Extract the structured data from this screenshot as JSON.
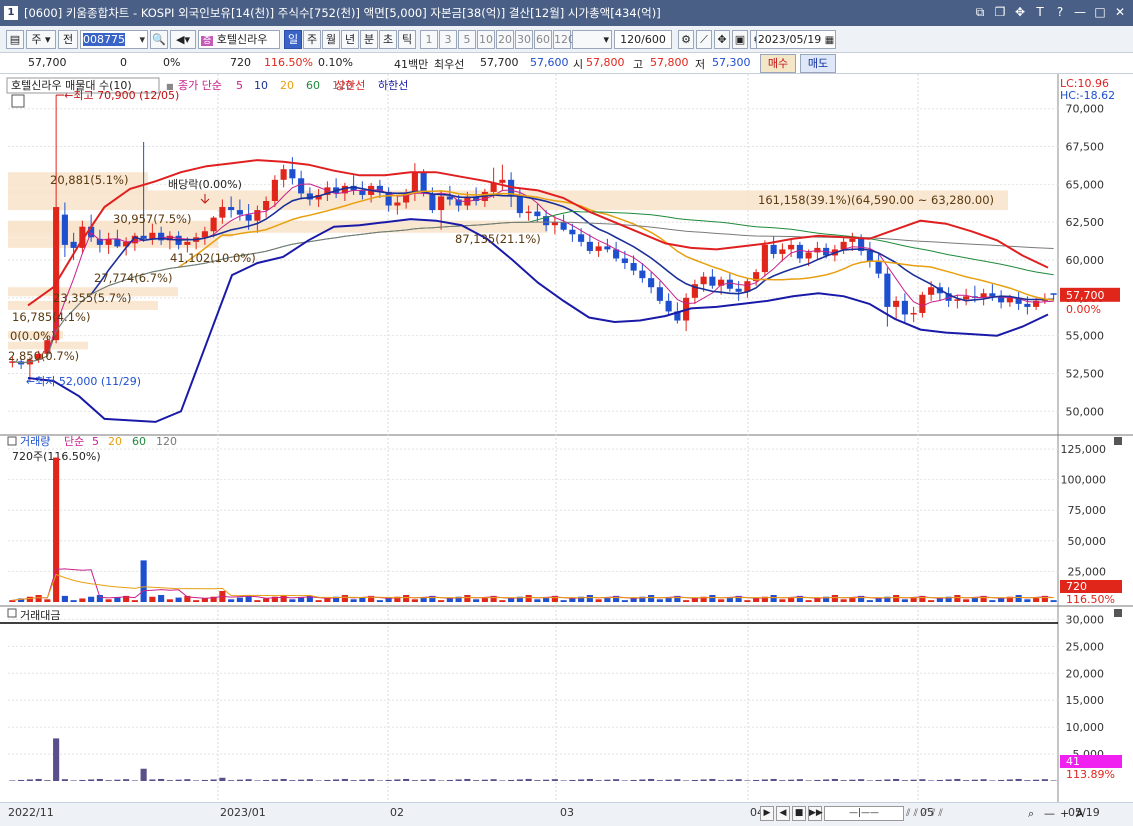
{
  "window": {
    "number": "1",
    "title": "[0600] 키움종합차트 - KOSPI 외국인보유[14(천)] 주식수[752(천)] 액면[5,000] 자본금[38(억)] 결산[12월] 시가총액[434(억)]",
    "controls": [
      "⧉",
      "❐",
      "✥",
      "T",
      "?",
      "—",
      "□",
      "✕"
    ]
  },
  "toolbar": {
    "market": "주",
    "prev_label": "전",
    "stock_code": "008775",
    "stock_name": "호텔신라우",
    "periods": [
      "일",
      "주",
      "월",
      "년",
      "분",
      "초",
      "틱"
    ],
    "selected_period": "일",
    "intervals": [
      "1",
      "3",
      "5",
      "10",
      "20",
      "30",
      "60",
      "120"
    ],
    "count": "120/600",
    "date": "2023/05/19"
  },
  "quote": {
    "price": "57,700",
    "change": "0",
    "change_pct": "0%",
    "volume": "720",
    "volume_ratio": "116.50%",
    "turnover": "0.10%",
    "amount": "41백만",
    "best_label": "최우선",
    "best": "57,700",
    "best2": "57,600",
    "open_label": "시",
    "open": "57,800",
    "high_label": "고",
    "high": "57,800",
    "low_label": "저",
    "low": "57,300",
    "buy_label": "매수",
    "sell_label": "매도"
  },
  "price_panel": {
    "legend_name": "호텔신라우 매물대 수(10)",
    "legend_ma": "종가 단순",
    "legend_periods": [
      "5",
      "10",
      "20",
      "60",
      "120"
    ],
    "legend_upper": "상한선",
    "legend_lower": "하한선",
    "lc": "LC:10.96",
    "hc": "HC:-18.62",
    "y_ticks": [
      "70,000",
      "67,500",
      "65,000",
      "62,500",
      "60,000",
      "57,500",
      "55,000",
      "52,500",
      "50,000"
    ],
    "current_price_tag": "57,700",
    "current_pct": "0.00%",
    "max_label": "최고 70,900 (12/05)",
    "min_label": "최저 52,000 (11/29)",
    "dividend_label": "배당락(0.00%)",
    "volume_profile_labels": [
      "20,881(5.1%)",
      "30,957(7.5%)",
      "41,102(10.0%)",
      "27,774(6.7%)",
      "23,355(5.7%)",
      "16,785(4.1%)",
      "0(0.0%)",
      "2,850(0.7%)",
      "87,135(21.1%)",
      "161,158(39.1%)(64,590.00 ~ 63,280.00)"
    ]
  },
  "volume_panel": {
    "legend_name": "거래량",
    "legend_ma": "단순",
    "legend_periods": [
      "5",
      "20",
      "60",
      "120"
    ],
    "info": "720주(116.50%)",
    "y_ticks": [
      "125,000",
      "100,000",
      "75,000",
      "50,000",
      "25,000"
    ],
    "tag": "720",
    "tag_pct": "116.50%"
  },
  "amount_panel": {
    "legend_name": "거래대금",
    "y_ticks": [
      "30,000",
      "25,000",
      "20,000",
      "15,000",
      "10,000",
      "5,000"
    ],
    "tag": "41",
    "tag_pct": "113.89%"
  },
  "x_axis": {
    "labels": [
      "2022/11",
      "2023/01",
      "02",
      "03",
      "04",
      "05",
      "05/19"
    ]
  },
  "colors": {
    "up": "#e0251b",
    "down": "#1d4fcf",
    "bb_upper": "#e02020",
    "bb_lower": "#1a1aa8",
    "ma5": "#c8208c",
    "ma10": "#1a2f9a",
    "ma20": "#e8a010",
    "ma60": "#1f8a3a",
    "ma120": "#7a7a7a",
    "profile": "#f8e4cc"
  },
  "chart_data": {
    "type": "candlestick",
    "x_range": [
      "2022/11/29",
      "2023/05/19"
    ],
    "ylim": [
      48500,
      71500
    ],
    "max": {
      "value": 70900,
      "date": "12/05"
    },
    "min": {
      "value": 52000,
      "date": "11/29"
    },
    "candles_approx": [
      [
        53200,
        53600,
        52900,
        53300
      ],
      [
        53300,
        53500,
        52800,
        53100
      ],
      [
        53100,
        53600,
        52000,
        53400
      ],
      [
        53400,
        54000,
        53200,
        53800
      ],
      [
        53800,
        55000,
        53600,
        54700
      ],
      [
        54700,
        70900,
        54500,
        63500
      ],
      [
        63000,
        63800,
        60200,
        61000
      ],
      [
        61200,
        61800,
        60000,
        60800
      ],
      [
        60800,
        62600,
        60500,
        62200
      ],
      [
        62200,
        63000,
        61200,
        61500
      ],
      [
        61400,
        62000,
        60500,
        61000
      ],
      [
        61000,
        61800,
        60400,
        61400
      ],
      [
        61400,
        62000,
        60800,
        60900
      ],
      [
        60900,
        61500,
        60300,
        61200
      ],
      [
        61100,
        61800,
        60600,
        61600
      ],
      [
        61600,
        67800,
        61200,
        61400
      ],
      [
        61400,
        62400,
        61000,
        61800
      ],
      [
        61800,
        62200,
        61000,
        61300
      ],
      [
        61300,
        61900,
        60700,
        61600
      ],
      [
        61600,
        61900,
        60700,
        61000
      ],
      [
        61000,
        61500,
        60500,
        61200
      ],
      [
        61200,
        61800,
        60700,
        61500
      ],
      [
        61500,
        62200,
        61000,
        61900
      ],
      [
        61900,
        62900,
        61500,
        62800
      ],
      [
        62800,
        64000,
        62400,
        63500
      ],
      [
        63500,
        64200,
        62800,
        63300
      ],
      [
        63300,
        64000,
        62600,
        63000
      ],
      [
        63000,
        63700,
        62000,
        62600
      ],
      [
        62600,
        63600,
        61800,
        63300
      ],
      [
        63300,
        64200,
        62800,
        63900
      ],
      [
        63900,
        65600,
        63500,
        65300
      ],
      [
        65300,
        66300,
        64800,
        66000
      ],
      [
        66000,
        66800,
        65000,
        65400
      ],
      [
        65400,
        65900,
        64000,
        64400
      ],
      [
        64400,
        64800,
        63600,
        64000
      ],
      [
        64000,
        64700,
        63500,
        64300
      ],
      [
        64300,
        65200,
        63900,
        64800
      ],
      [
        64800,
        65400,
        64100,
        64400
      ],
      [
        64400,
        65100,
        63900,
        64900
      ],
      [
        64900,
        65600,
        64300,
        64600
      ],
      [
        64600,
        65200,
        64000,
        64300
      ],
      [
        64300,
        65100,
        63800,
        64900
      ],
      [
        64900,
        65300,
        64100,
        64500
      ],
      [
        64500,
        64800,
        63200,
        63600
      ],
      [
        63600,
        64200,
        63000,
        63800
      ],
      [
        63800,
        64700,
        63400,
        64400
      ],
      [
        64400,
        66400,
        63900,
        65800
      ],
      [
        65800,
        66000,
        64200,
        64400
      ],
      [
        64400,
        64800,
        63100,
        63300
      ],
      [
        63300,
        64600,
        62000,
        64200
      ],
      [
        64200,
        64900,
        63600,
        64000
      ],
      [
        64000,
        64300,
        63200,
        63600
      ],
      [
        63600,
        64500,
        63300,
        64200
      ],
      [
        64200,
        64800,
        63600,
        63900
      ],
      [
        63900,
        64700,
        63500,
        64500
      ],
      [
        64500,
        66100,
        64100,
        65100
      ],
      [
        65100,
        66300,
        64600,
        65300
      ],
      [
        65300,
        65800,
        63500,
        64300
      ],
      [
        64300,
        64800,
        62800,
        63100
      ],
      [
        63100,
        63600,
        62600,
        63200
      ],
      [
        63200,
        63700,
        62500,
        62900
      ],
      [
        62900,
        63300,
        61900,
        62300
      ],
      [
        62300,
        62900,
        61700,
        62500
      ],
      [
        62500,
        63000,
        61900,
        62000
      ],
      [
        62000,
        62400,
        61200,
        61700
      ],
      [
        61700,
        62100,
        60900,
        61200
      ],
      [
        61200,
        61700,
        60400,
        60600
      ],
      [
        60600,
        61200,
        60200,
        60900
      ],
      [
        60900,
        61400,
        60500,
        60700
      ],
      [
        60700,
        61200,
        59900,
        60100
      ],
      [
        60100,
        60600,
        59400,
        59800
      ],
      [
        59800,
        60300,
        59000,
        59300
      ],
      [
        59300,
        59800,
        58500,
        58800
      ],
      [
        58800,
        59200,
        57800,
        58200
      ],
      [
        58200,
        58600,
        57100,
        57300
      ],
      [
        57300,
        57800,
        56300,
        56600
      ],
      [
        56600,
        57200,
        55800,
        56000
      ],
      [
        56000,
        57800,
        55300,
        57500
      ],
      [
        57500,
        58700,
        57100,
        58400
      ],
      [
        58400,
        59200,
        57900,
        58900
      ],
      [
        58900,
        59400,
        58100,
        58300
      ],
      [
        58300,
        58900,
        57700,
        58700
      ],
      [
        58700,
        59100,
        57900,
        58100
      ],
      [
        58100,
        58600,
        57300,
        57900
      ],
      [
        57900,
        58800,
        57500,
        58600
      ],
      [
        58600,
        59400,
        58300,
        59200
      ],
      [
        59200,
        61300,
        58900,
        61000
      ],
      [
        61000,
        61600,
        60100,
        60400
      ],
      [
        60400,
        61100,
        59900,
        60700
      ],
      [
        60700,
        61400,
        60200,
        61000
      ],
      [
        61000,
        61200,
        59800,
        60100
      ],
      [
        60100,
        60700,
        59600,
        60500
      ],
      [
        60500,
        61200,
        60000,
        60800
      ],
      [
        60800,
        61100,
        60100,
        60300
      ],
      [
        60300,
        61000,
        59900,
        60700
      ],
      [
        60700,
        61500,
        60400,
        61200
      ],
      [
        61200,
        61800,
        60600,
        61400
      ],
      [
        61400,
        61700,
        60300,
        60600
      ],
      [
        60600,
        61200,
        59500,
        59900
      ],
      [
        59900,
        60400,
        58800,
        59100
      ],
      [
        59100,
        59500,
        55600,
        56900
      ],
      [
        56900,
        57600,
        56100,
        57300
      ],
      [
        57300,
        57800,
        55800,
        56400
      ],
      [
        56400,
        56900,
        55900,
        56500
      ],
      [
        56500,
        57900,
        56200,
        57700
      ],
      [
        57700,
        58600,
        57300,
        58200
      ],
      [
        58200,
        58500,
        57300,
        57800
      ],
      [
        57800,
        58200,
        56900,
        57300
      ],
      [
        57300,
        57700,
        56800,
        57400
      ],
      [
        57400,
        58100,
        57000,
        57600
      ],
      [
        57600,
        58300,
        57200,
        57500
      ],
      [
        57500,
        58100,
        57000,
        57800
      ],
      [
        57800,
        58400,
        57300,
        57600
      ],
      [
        57600,
        58000,
        56800,
        57200
      ],
      [
        57200,
        57700,
        56900,
        57500
      ],
      [
        57500,
        57900,
        56700,
        57100
      ],
      [
        57100,
        57600,
        56400,
        56900
      ],
      [
        56900,
        57500,
        56700,
        57300
      ],
      [
        57300,
        57800,
        57100,
        57400
      ],
      [
        57800,
        57800,
        57300,
        57700
      ]
    ],
    "bollinger_upper_approx": [
      57000,
      58200,
      61000,
      63500,
      64700,
      65200,
      65800,
      66200,
      66400,
      66600,
      66500,
      66300,
      65900,
      65600,
      65600,
      65800,
      65800,
      65500,
      65200,
      64800,
      64600,
      64100,
      63200,
      62500,
      61800,
      61100,
      60800,
      60700,
      60900,
      61100,
      61400,
      61600,
      61500,
      61400,
      62000,
      62600,
      62400,
      61900,
      61300,
      60300,
      59500
    ],
    "bollinger_lower_approx": [
      52200,
      52000,
      51000,
      49500,
      49400,
      49300,
      50000,
      54500,
      59000,
      59800,
      60200,
      61300,
      62200,
      62300,
      62500,
      62700,
      62600,
      62300,
      61400,
      60000,
      58500,
      57300,
      56200,
      55900,
      56000,
      56300,
      56800,
      56900,
      57100,
      57300,
      57600,
      57800,
      57600,
      57100,
      56100,
      55400,
      55200,
      55100,
      55000,
      55600,
      56400
    ]
  }
}
